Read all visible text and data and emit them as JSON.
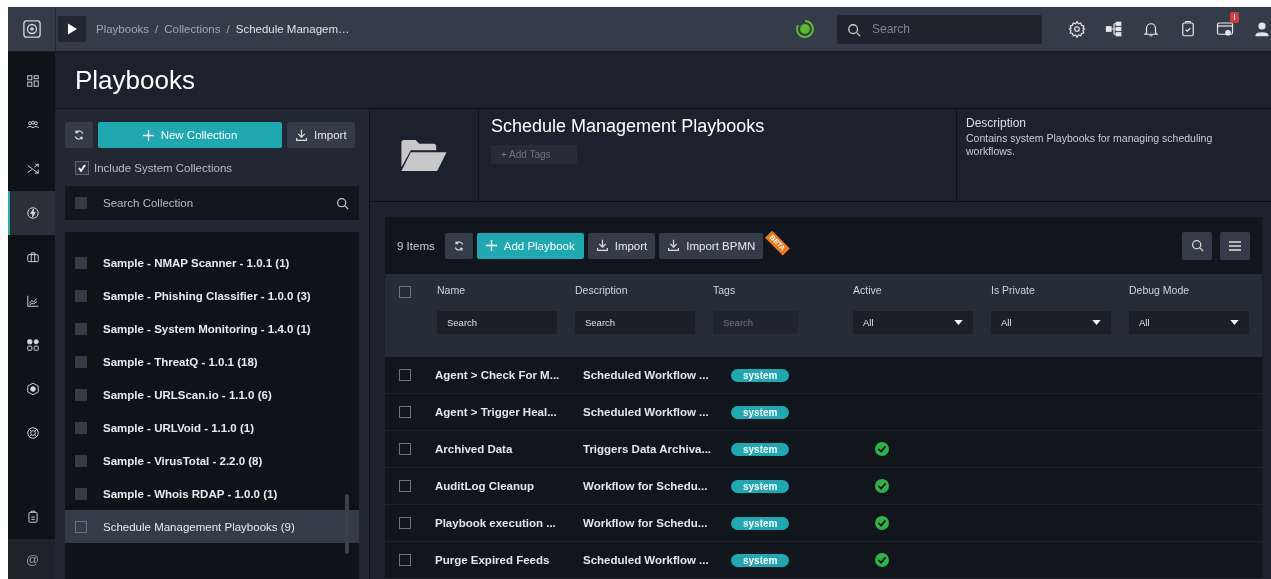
{
  "topbar": {
    "breadcrumbs": [
      {
        "label": "Playbooks",
        "current": false
      },
      {
        "separator": "/",
        "label": "Collections",
        "current": false
      },
      {
        "separator": "/",
        "label": "Schedule Managem…",
        "current": true
      }
    ],
    "search": {
      "placeholder": "Search"
    },
    "alert_badge": "!"
  },
  "rail": [
    {
      "selected": false
    },
    {
      "selected": false
    },
    {
      "selected": false
    },
    {
      "selected": true
    },
    {
      "selected": false
    },
    {
      "selected": false
    },
    {
      "selected": false
    },
    {
      "selected": false
    },
    {
      "selected": false
    }
  ],
  "rail_bottom": {
    "at": "@"
  },
  "page_title": "Playbooks",
  "collections": {
    "new_button": "New Collection",
    "import_button": "Import",
    "include_system": {
      "label": "Include System Collections",
      "checked": true
    },
    "search": {
      "placeholder": "Search Collection",
      "select_all_checked": false
    },
    "items": [
      {
        "label": "Sample - NMAP Scanner - 1.0.1 (1)",
        "checked": false,
        "selected": false
      },
      {
        "label": "Sample - Phishing Classifier - 1.0.0 (3)",
        "checked": false,
        "selected": false
      },
      {
        "label": "Sample - System Monitoring - 1.4.0 (1)",
        "checked": false,
        "selected": false
      },
      {
        "label": "Sample - ThreatQ - 1.0.1 (18)",
        "checked": false,
        "selected": false
      },
      {
        "label": "Sample - URLScan.io - 1.1.0 (6)",
        "checked": false,
        "selected": false
      },
      {
        "label": "Sample - URLVoid - 1.1.0 (1)",
        "checked": false,
        "selected": false
      },
      {
        "label": "Sample - VirusTotal - 2.2.0 (8)",
        "checked": false,
        "selected": false
      },
      {
        "label": "Sample - Whois RDAP - 1.0.0 (1)",
        "checked": false,
        "selected": false
      },
      {
        "label": "Schedule Management Playbooks (9)",
        "checked": false,
        "selected": true
      }
    ]
  },
  "collection_header": {
    "title": "Schedule Management Playbooks",
    "add_tags": "+ Add Tags",
    "description_label": "Description",
    "description": "Contains system Playbooks for managing scheduling workflows."
  },
  "table": {
    "count": "9 Items",
    "add_button": "Add Playbook",
    "import_button": "Import",
    "import_bpmn_button": "Import BPMN",
    "beta_ribbon": "BETA",
    "select_all_checked": false,
    "columns": [
      {
        "label": "Name",
        "filter": {
          "kind": "text",
          "placeholder": "Search",
          "disabled": false
        }
      },
      {
        "label": "Description",
        "filter": {
          "kind": "text",
          "placeholder": "Search",
          "disabled": false
        }
      },
      {
        "label": "Tags",
        "filter": {
          "kind": "text",
          "placeholder": "Search",
          "disabled": true
        }
      },
      {
        "label": "Active",
        "filter": {
          "kind": "select",
          "value": "All"
        }
      },
      {
        "label": "Is Private",
        "filter": {
          "kind": "select",
          "value": "All"
        }
      },
      {
        "label": "Debug Mode",
        "filter": {
          "kind": "select",
          "value": "All"
        }
      }
    ],
    "rows": [
      {
        "checked": false,
        "name": "Agent > Check For M...",
        "description": "Scheduled Workflow ...",
        "tags": [
          "system"
        ],
        "active": false
      },
      {
        "checked": false,
        "name": "Agent > Trigger Heal...",
        "description": "Scheduled Workflow ...",
        "tags": [
          "system"
        ],
        "active": false
      },
      {
        "checked": false,
        "name": "Archived Data",
        "description": "Triggers Data Archiva...",
        "tags": [
          "system"
        ],
        "active": true
      },
      {
        "checked": false,
        "name": "AuditLog Cleanup",
        "description": "Workflow for Schedu...",
        "tags": [
          "system"
        ],
        "active": true
      },
      {
        "checked": false,
        "name": "Playbook execution ...",
        "description": "Workflow for Schedu...",
        "tags": [
          "system"
        ],
        "active": true
      },
      {
        "checked": false,
        "name": "Purge Expired Feeds",
        "description": "Scheduled Workflow ...",
        "tags": [
          "system"
        ],
        "active": true
      }
    ]
  }
}
